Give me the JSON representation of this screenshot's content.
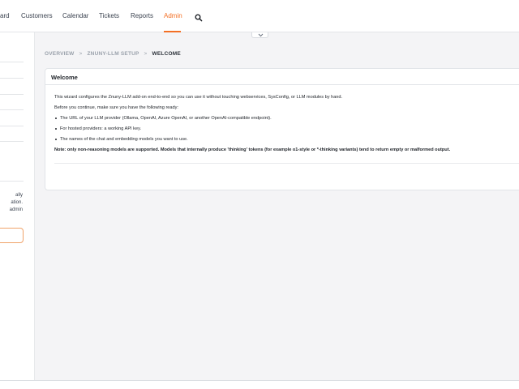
{
  "nav": {
    "items": [
      {
        "label": "ard",
        "active": false
      },
      {
        "label": "Customers",
        "active": false
      },
      {
        "label": "Calendar",
        "active": false
      },
      {
        "label": "Tickets",
        "active": false
      },
      {
        "label": "Reports",
        "active": false
      },
      {
        "label": "Admin",
        "active": true
      }
    ],
    "search_icon": "search-icon",
    "accent_color": "#f36f24"
  },
  "sidebar": {
    "text_lines": [
      "ally",
      "ation.",
      "admin"
    ]
  },
  "breadcrumb": {
    "items": [
      "OVERVIEW",
      "ZNUNY-LLM SETUP"
    ],
    "current": "WELCOME",
    "separator_icon": "chevron-right-icon"
  },
  "card": {
    "title": "Welcome",
    "intro": "This wizard configures the Znuny-LLM add-on end-to-end so you can use it without touching webservices, SysConfig, or LLM modules by hand.",
    "lead": "Before you continue, make sure you have the following ready:",
    "bullets": [
      "The URL of your LLM provider (Ollama, OpenAI, Azure OpenAI, or another OpenAI-compatible endpoint).",
      "For hosted providers: a working API key.",
      "The names of the chat and embedding models you want to use."
    ],
    "note": "Note: only non-reasoning models are supported. Models that internally produce 'thinking' tokens (for example o1-style or *-thinking variants) tend to return empty or malformed output."
  }
}
